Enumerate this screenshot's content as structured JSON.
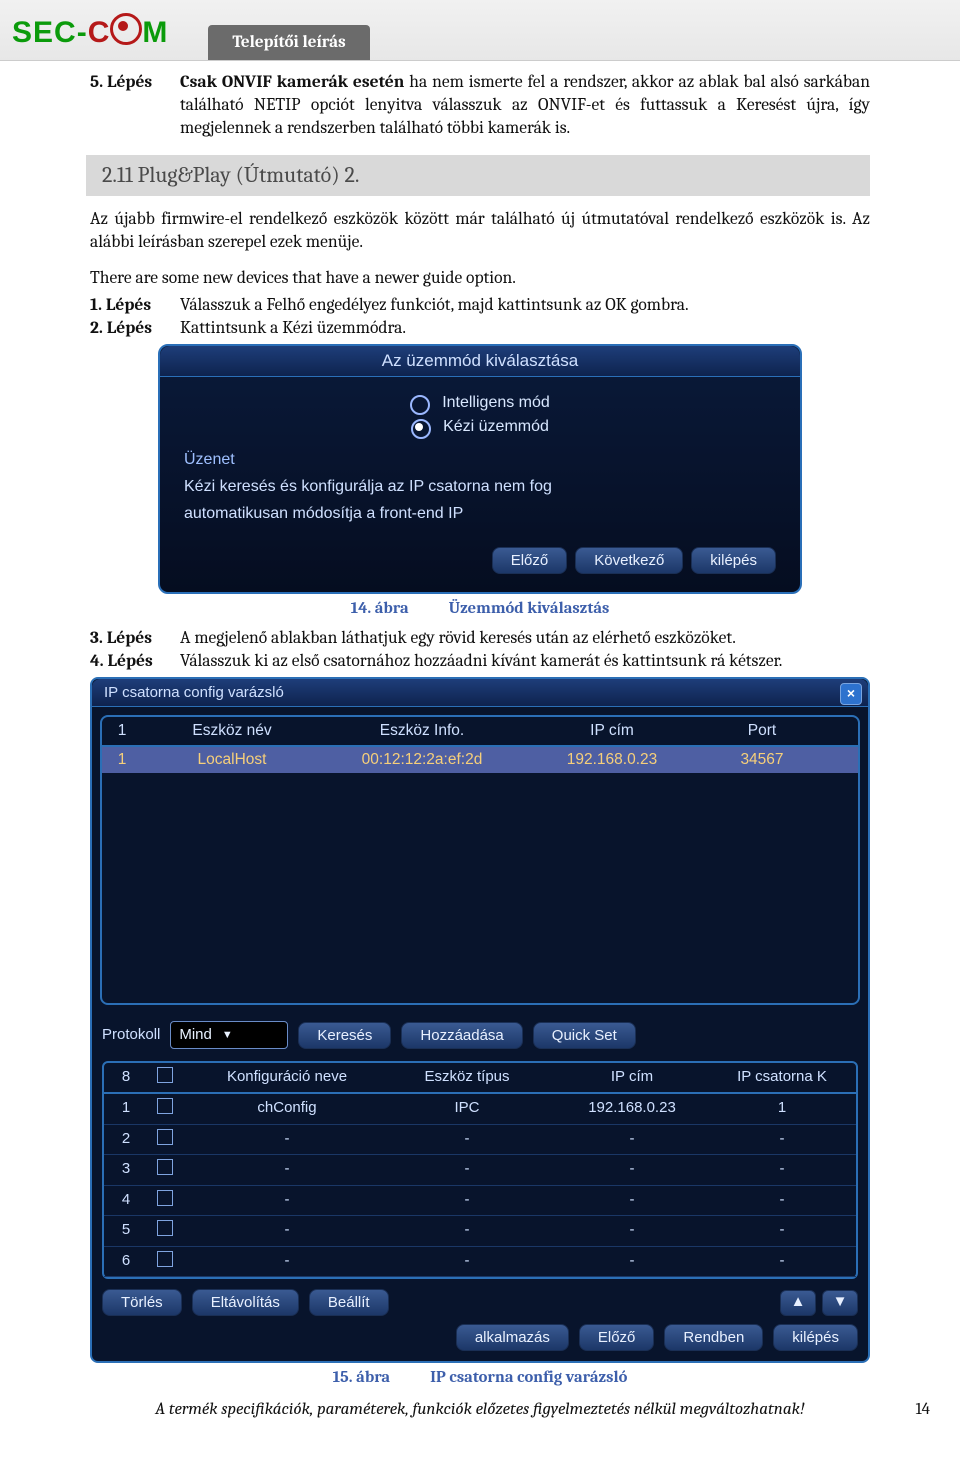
{
  "header": {
    "logo_sec": "SEC",
    "logo_dash": "-",
    "logo_c": "C",
    "logo_am": "M",
    "tab": "Telepítői leírás"
  },
  "body": {
    "step5_lbl": "5. Lépés",
    "step5_txt": "Csak ONVIF kamerák esetén ha nem ismerte fel a rendszer, akkor az ablak bal alsó sarkában található NETIP opciót lenyitva válasszuk az ONVIF-et és futtassuk a Keresést újra, így megjelennek a rendszerben található többi kamerák is.",
    "heading": "2.11 Plug&Play (Útmutató) 2.",
    "para1": "Az újabb firmwire-el rendelkező eszközök között már található új útmutatóval rendelkező eszközök is. Az alábbi leírásban szerepel ezek menüje.",
    "para2": "There are some new devices that have a newer guide option.",
    "step1_lbl": "1. Lépés",
    "step1_txt": "Válasszuk a Felhő engedélyez funkciót, majd kattintsunk az OK gombra.",
    "step2_lbl": "2. Lépés",
    "step2_txt": "Kattintsunk a Kézi üzemmódra.",
    "caption1_num": "14. ábra",
    "caption1_txt": "Üzemmód kiválasztás",
    "step3_lbl": "3. Lépés",
    "step3_txt": "A megjelenő ablakban láthatjuk egy rövid keresés után az elérhető eszközöket.",
    "step4_lbl": "4. Lépés",
    "step4_txt": "Válasszuk ki az első csatornához hozzáadni kívánt kamerát és kattintsunk rá kétszer.",
    "caption2_num": "15. ábra",
    "caption2_txt": "IP csatorna config varázsló"
  },
  "shot1": {
    "title": "Az üzemmód kiválasztása",
    "opt1": "Intelligens mód",
    "opt2": "Kézi üzemmód",
    "legend": "Üzenet",
    "msg1": "Kézi keresés és konfigurálja az IP csatorna nem fog",
    "msg2": "automatikusan módosítja a front-end IP",
    "btn_prev": "Előző",
    "btn_next": "Következő",
    "btn_exit": "kilépés"
  },
  "shot2": {
    "title": "IP csatorna config varázsló",
    "hdr": {
      "c0": "1",
      "c1": "Eszköz név",
      "c2": "Eszköz Info.",
      "c3": "IP cím",
      "c4": "Port"
    },
    "row": {
      "c0": "1",
      "c1": "LocalHost",
      "c2": "00:12:12:2a:ef:2d",
      "c3": "192.168.0.23",
      "c4": "34567"
    },
    "proto_lbl": "Protokoll",
    "proto_val": "Mind",
    "btn_search": "Keresés",
    "btn_add": "Hozzáadása",
    "btn_quick": "Quick Set",
    "hdr2": {
      "c0": "8",
      "c1": "Konfiguráció neve",
      "c2": "Eszköz típus",
      "c3": "IP cím",
      "c4": "IP csatorna K"
    },
    "rows2": [
      {
        "n": "1",
        "name": "chConfig",
        "type": "IPC",
        "ip": "192.168.0.23",
        "ch": "1"
      },
      {
        "n": "2",
        "name": "-",
        "type": "-",
        "ip": "-",
        "ch": "-"
      },
      {
        "n": "3",
        "name": "-",
        "type": "-",
        "ip": "-",
        "ch": "-"
      },
      {
        "n": "4",
        "name": "-",
        "type": "-",
        "ip": "-",
        "ch": "-"
      },
      {
        "n": "5",
        "name": "-",
        "type": "-",
        "ip": "-",
        "ch": "-"
      },
      {
        "n": "6",
        "name": "-",
        "type": "-",
        "ip": "-",
        "ch": "-"
      }
    ],
    "btn_del": "Törlés",
    "btn_remove": "Eltávolítás",
    "btn_set": "Beállít",
    "btn_apply": "alkalmazás",
    "btn_prev": "Előző",
    "btn_ok": "Rendben",
    "btn_exit": "kilépés"
  },
  "footer": {
    "text": "A termék specifikációk, paraméterek, funkciók előzetes figyelmeztetés nélkül megváltozhatnak!",
    "page": "14"
  }
}
